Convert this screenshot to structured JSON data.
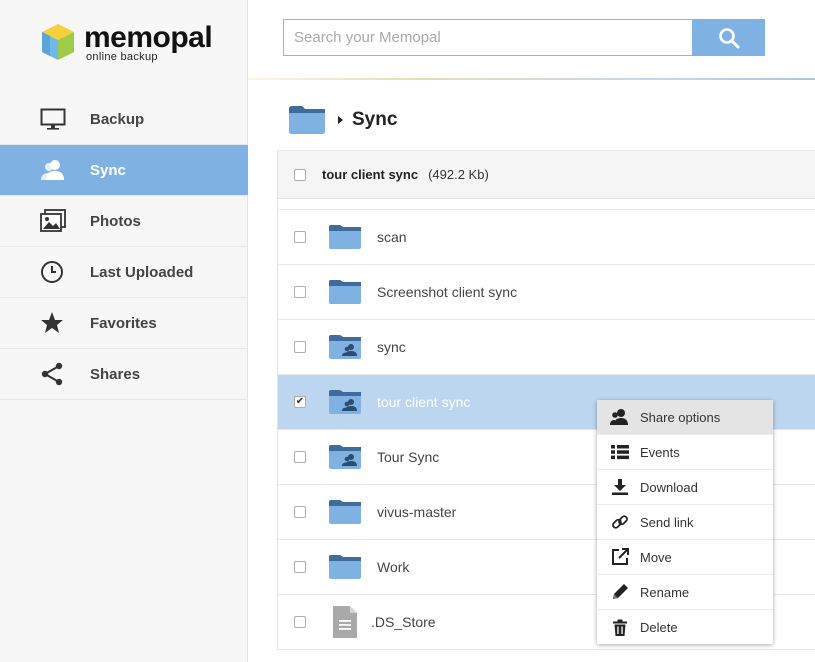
{
  "brand": {
    "name": "memopal",
    "tagline": "online backup"
  },
  "search": {
    "placeholder": "Search your Memopal",
    "value": ""
  },
  "sidebar": {
    "items": [
      {
        "label": "Backup",
        "icon": "monitor-icon",
        "active": false
      },
      {
        "label": "Sync",
        "icon": "user-sync-icon",
        "active": true
      },
      {
        "label": "Photos",
        "icon": "photos-icon",
        "active": false
      },
      {
        "label": "Last Uploaded",
        "icon": "clock-icon",
        "active": false
      },
      {
        "label": "Favorites",
        "icon": "star-icon",
        "active": false
      },
      {
        "label": "Shares",
        "icon": "share-icon",
        "active": false
      }
    ]
  },
  "breadcrumb": {
    "current": "Sync"
  },
  "list": {
    "header": {
      "name": "tour client sync",
      "size": "(492.2 Kb)"
    },
    "rows": [
      {
        "name": "scan",
        "type": "folder",
        "checked": false
      },
      {
        "name": "Screenshot client sync",
        "type": "folder",
        "checked": false
      },
      {
        "name": "sync",
        "type": "shared-folder",
        "checked": false
      },
      {
        "name": "tour client sync",
        "type": "shared-folder",
        "checked": true
      },
      {
        "name": "Tour Sync",
        "type": "shared-folder",
        "checked": false
      },
      {
        "name": "vivus-master",
        "type": "folder",
        "checked": false
      },
      {
        "name": "Work",
        "type": "folder",
        "checked": false
      },
      {
        "name": ".DS_Store",
        "type": "file",
        "checked": false
      }
    ]
  },
  "context_menu": {
    "items": [
      {
        "label": "Share options",
        "icon": "share-options-icon"
      },
      {
        "label": "Events",
        "icon": "events-list-icon"
      },
      {
        "label": "Download",
        "icon": "download-icon"
      },
      {
        "label": "Send link",
        "icon": "link-icon"
      },
      {
        "label": "Move",
        "icon": "move-icon"
      },
      {
        "label": "Rename",
        "icon": "pencil-icon"
      },
      {
        "label": "Delete",
        "icon": "trash-icon"
      }
    ]
  },
  "colors": {
    "accent": "#7fb1e3",
    "selected_row": "#bcd6ef",
    "folder": "#7fb1e3",
    "folder_tab": "#3f6c9a"
  }
}
